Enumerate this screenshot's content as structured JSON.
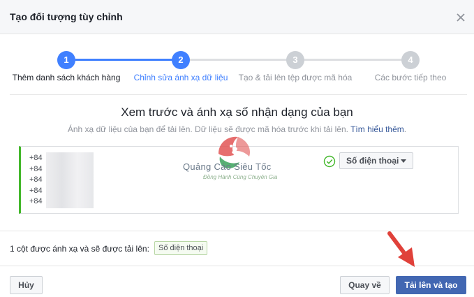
{
  "dialog": {
    "title": "Tạo đối tượng tùy chỉnh"
  },
  "stepper": {
    "steps": [
      {
        "number": "1",
        "label": "Thêm danh sách khách hàng",
        "state": "completed"
      },
      {
        "number": "2",
        "label": "Chỉnh sửa ánh xạ dữ liệu",
        "state": "active"
      },
      {
        "number": "3",
        "label": "Tạo & tải lên tệp được mã hóa",
        "state": "pending"
      },
      {
        "number": "4",
        "label": "Các bước tiếp theo",
        "state": "pending"
      }
    ]
  },
  "section": {
    "title": "Xem trước và ánh xạ số nhận dạng của bạn",
    "description": "Ánh xạ dữ liệu của bạn để tải lên. Dữ liệu sẽ được mã hóa trước khi tải lên.",
    "learn_more": "Tìm hiểu thêm"
  },
  "preview": {
    "rows": [
      "+84",
      "+84",
      "+84",
      "+84",
      "+84"
    ],
    "mapping_select": "Số điện thoại"
  },
  "watermark": {
    "brand": "Quảng Cáo Siêu Tốc",
    "tagline": "Đồng Hành Cùng Chuyên Gia"
  },
  "summary": {
    "text": "1 cột được ánh xạ và sẽ được tải lên:",
    "badge": "Số điện thoại"
  },
  "footer": {
    "cancel_label": "Hủy",
    "back_label": "Quay về",
    "upload_label": "Tải lên và tạo"
  },
  "colors": {
    "accent": "#4267b2",
    "step_active": "#4080ff",
    "step_pending": "#ccd0d5",
    "mapped_border": "#42b72a",
    "annotation_arrow": "#e0413a"
  }
}
